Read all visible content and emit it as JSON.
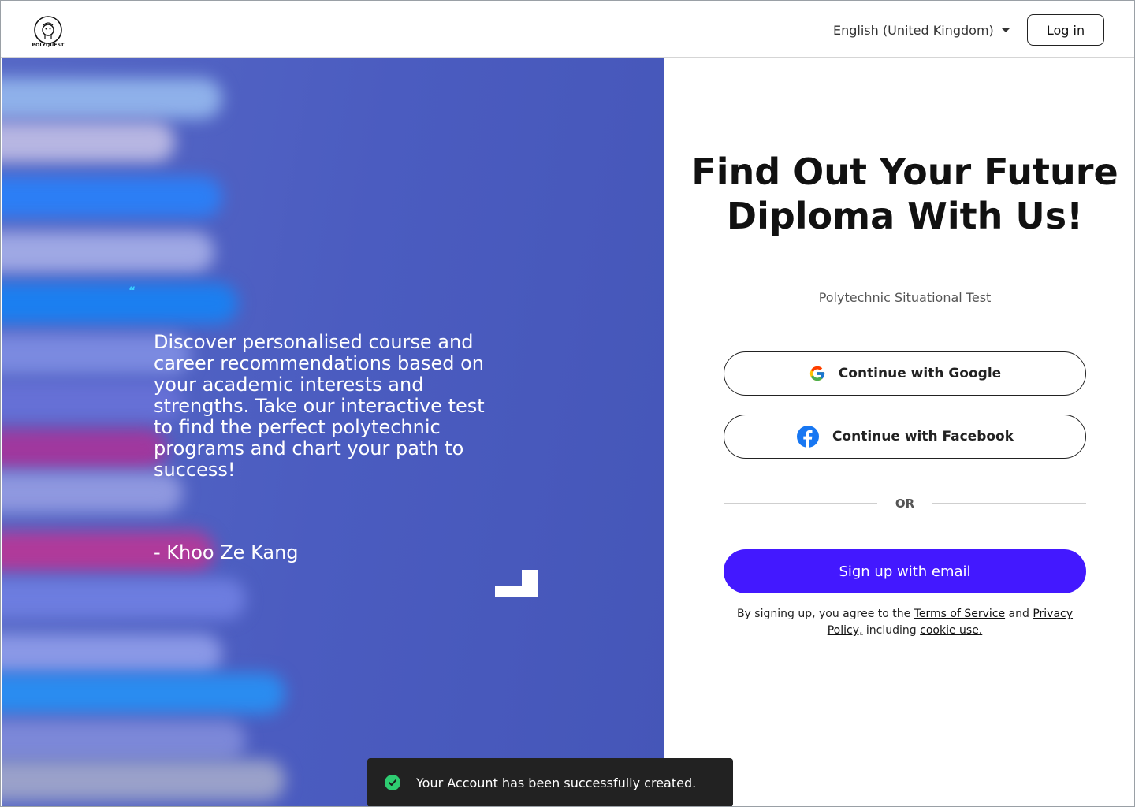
{
  "header": {
    "logo_text": "POLYQUEST",
    "language": "English (United Kingdom)",
    "login_label": "Log in"
  },
  "hero": {
    "quote_mark": "“",
    "quote": "Discover personalised course and career recommendations based on your academic interests and strengths. Take our interactive test to find the perfect polytechnic programs and chart your path to success!",
    "author": "- Khoo Ze Kang"
  },
  "signup": {
    "title": "Find Out Your Future Diploma With Us!",
    "subtitle": "Polytechnic Situational Test",
    "google_label": "Continue with Google",
    "facebook_label": "Continue with Facebook",
    "or_label": "OR",
    "email_label": "Sign up with email",
    "terms_prefix": "By signing up, you agree to the ",
    "terms_link": "Terms of Service",
    "terms_and": " and ",
    "privacy_link": "Privacy Policy,",
    "terms_including": " including ",
    "cookie_link": "cookie use."
  },
  "toast": {
    "message": "Your Account has been successfully created.",
    "status_color": "#2ecc71"
  },
  "colors": {
    "primary": "#4318ff",
    "hero_blue": "#4a5bc0"
  }
}
